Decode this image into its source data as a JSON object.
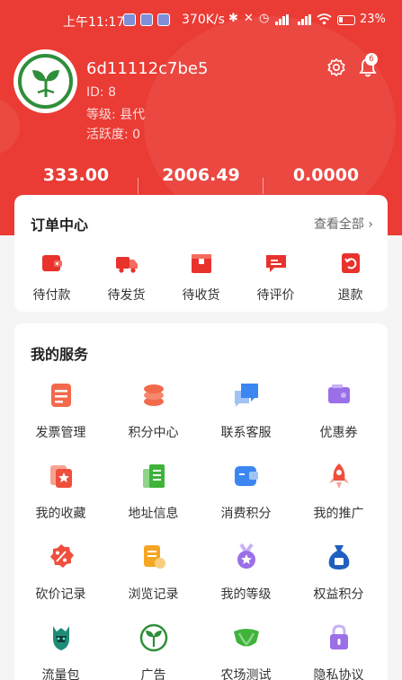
{
  "status_bar": {
    "time": "上午11:17",
    "network_speed": "370K/s",
    "battery": "23%"
  },
  "profile": {
    "username": "6d11112c7be5",
    "id_line": "ID: 8",
    "level_line": "等级: 县代",
    "activity_line": "活跃度: 0",
    "notification_count": "6"
  },
  "stats": [
    "333.00",
    "2006.49",
    "0.0000"
  ],
  "orders": {
    "title": "订单中心",
    "see_all": "查看全部",
    "items": [
      {
        "label": "待付款",
        "icon": "wallet-icon"
      },
      {
        "label": "待发货",
        "icon": "truck-icon"
      },
      {
        "label": "待收货",
        "icon": "package-icon"
      },
      {
        "label": "待评价",
        "icon": "comment-icon"
      },
      {
        "label": "退款",
        "icon": "refund-icon"
      }
    ]
  },
  "services": {
    "title": "我的服务",
    "items": [
      {
        "label": "发票管理",
        "icon": "invoice-icon"
      },
      {
        "label": "积分中心",
        "icon": "coins-icon"
      },
      {
        "label": "联系客服",
        "icon": "chat-icon"
      },
      {
        "label": "优惠券",
        "icon": "coupon-icon"
      },
      {
        "label": "我的收藏",
        "icon": "favorites-icon"
      },
      {
        "label": "地址信息",
        "icon": "address-icon"
      },
      {
        "label": "消费积分",
        "icon": "points-icon"
      },
      {
        "label": "我的推广",
        "icon": "rocket-icon"
      },
      {
        "label": "砍价记录",
        "icon": "discount-icon"
      },
      {
        "label": "浏览记录",
        "icon": "history-icon"
      },
      {
        "label": "我的等级",
        "icon": "medal-icon"
      },
      {
        "label": "权益积分",
        "icon": "money-bag-icon"
      },
      {
        "label": "流量包",
        "icon": "warrior-icon"
      },
      {
        "label": "广告",
        "icon": "sprout-icon"
      },
      {
        "label": "农场测试",
        "icon": "farm-icon"
      },
      {
        "label": "隐私协议",
        "icon": "lock-icon"
      }
    ]
  },
  "colors": {
    "brand_red": "#ea3b34",
    "page_bg": "#f5f5f5",
    "logo_green": "#2f8e3a"
  }
}
